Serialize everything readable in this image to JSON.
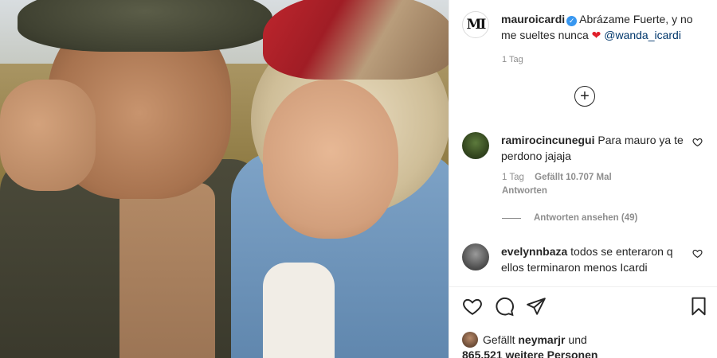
{
  "post": {
    "author": {
      "username": "mauroicardi",
      "logo_letters": "MI",
      "verified_icon": "verified-check-icon"
    },
    "caption": {
      "text_1": "Abrázame Fuerte, y no",
      "text_2": "me sueltes nunca",
      "emoji": "❤",
      "mention": "@wanda_icardi",
      "time": "1 Tag"
    },
    "load_more_icon": "plus-circle-icon",
    "load_more_glyph": "+",
    "comments": [
      {
        "username": "ramirocincunegui",
        "text": "Para mauro ya te perdono jajaja",
        "time": "1 Tag",
        "likes": "Gefällt 10.707 Mal",
        "reply": "Antworten",
        "view_replies": "Antworten ansehen (49)",
        "like_icon": "heart-outline-icon"
      },
      {
        "username": "evelynnbaza",
        "text": "todos se enteraron q ellos terminaron menos Icardi",
        "like_icon": "heart-outline-icon"
      }
    ],
    "actions": {
      "like_icon": "heart-outline-icon",
      "comment_icon": "comment-icon",
      "share_icon": "paper-plane-icon",
      "save_icon": "bookmark-icon"
    },
    "likes_summary": {
      "prefix": "Gefällt",
      "user": "neymarjr",
      "conjunction": "und",
      "count": "865.521 weitere Personen"
    },
    "colors": {
      "verified": "#3897f0",
      "heart": "#e0202b",
      "mention": "#00376b",
      "muted": "#8e8e8e"
    }
  }
}
